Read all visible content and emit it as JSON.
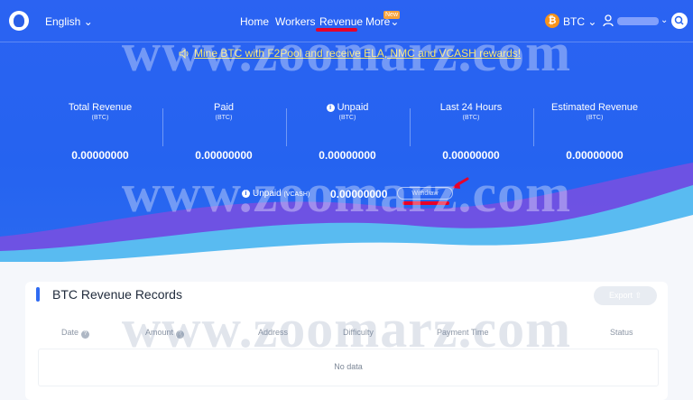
{
  "header": {
    "language": "English",
    "nav": [
      {
        "label": "Home"
      },
      {
        "label": "Workers"
      },
      {
        "label": "Revenue"
      },
      {
        "label": "More"
      }
    ],
    "new_badge": "New",
    "currency": "BTC"
  },
  "announcement": "Mine BTC with F2Pool and receive ELA, NMC and VCASH rewards!",
  "stats": [
    {
      "title": "Total Revenue",
      "unit": "(BTC)",
      "value": "0.00000000"
    },
    {
      "title": "Paid",
      "unit": "(BTC)",
      "value": "0.00000000"
    },
    {
      "title": "Unpaid",
      "unit": "(BTC)",
      "value": "0.00000000"
    },
    {
      "title": "Last 24 Hours",
      "unit": "(BTC)",
      "value": "0.00000000"
    },
    {
      "title": "Estimated Revenue",
      "unit": "(BTC)",
      "value": "0.00000000"
    }
  ],
  "vcash": {
    "label": "Unpaid",
    "unit": "(VCASH)",
    "value": "0.00000000",
    "withdraw_label": "Withdraw"
  },
  "records": {
    "title": "BTC Revenue Records",
    "export_label": "Export",
    "columns": [
      "Date",
      "Amount",
      "Address",
      "Difficulty",
      "Payment Time",
      "Status"
    ],
    "empty_text": "No data"
  },
  "watermark": "www.zoomarz.com",
  "colors": {
    "hero_blue": "#2563f0",
    "highlight_red": "#e6002a",
    "announcement_yellow": "#f5e36a",
    "btc_orange": "#f7931a"
  }
}
